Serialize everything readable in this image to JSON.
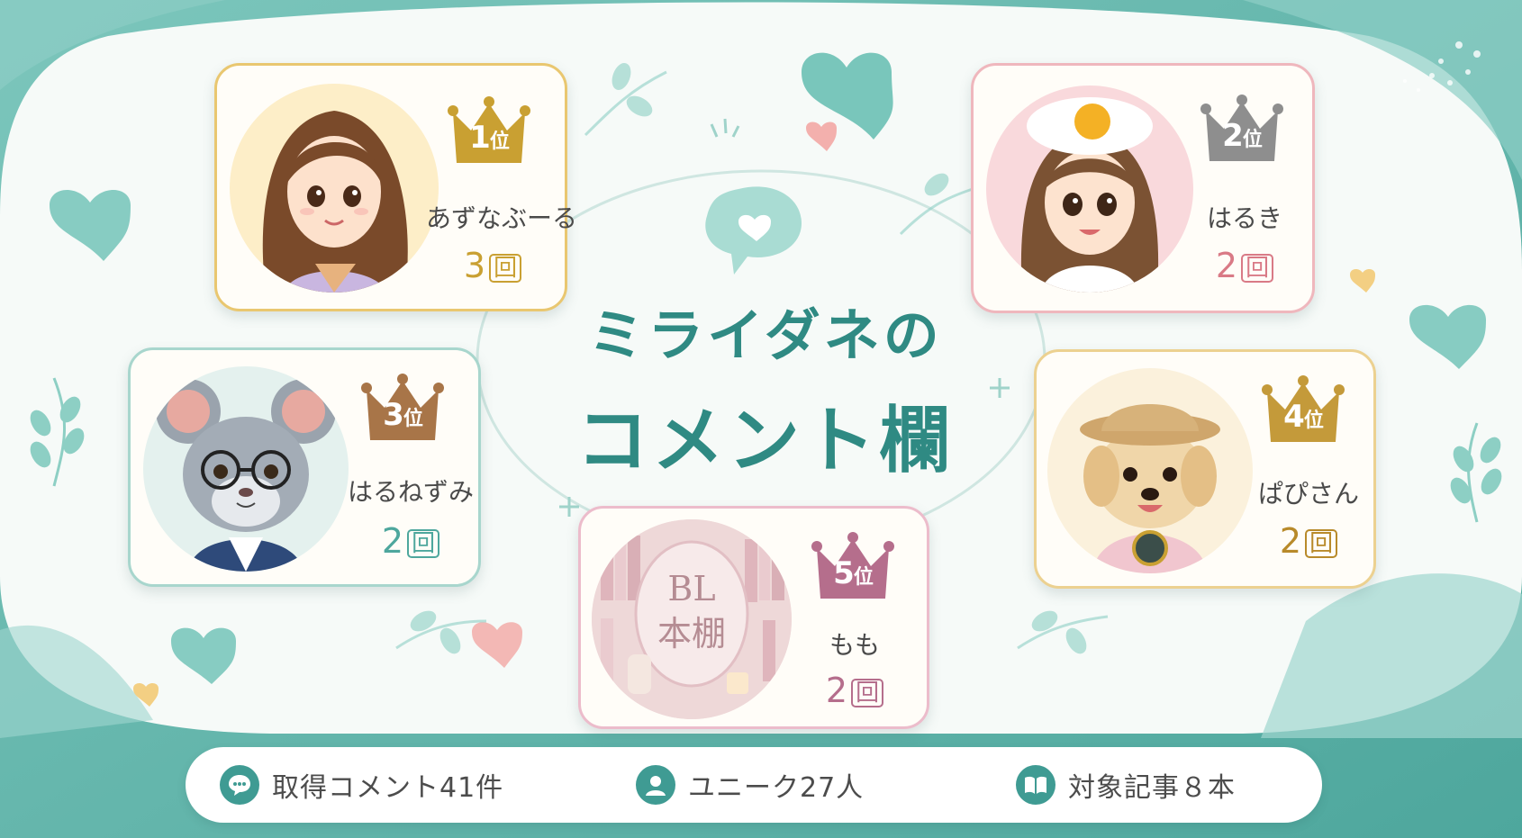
{
  "title": {
    "line1": "ミライダネの",
    "line2": "コメント欄"
  },
  "ranking": [
    {
      "rank_num": "1",
      "rank_suffix": "位",
      "name": "あずなぶーる",
      "count": "3",
      "unit": "回",
      "color": "#c9a032"
    },
    {
      "rank_num": "2",
      "rank_suffix": "位",
      "name": "はるき",
      "count": "2",
      "unit": "回",
      "color": "#8e8e8e"
    },
    {
      "rank_num": "3",
      "rank_suffix": "位",
      "name": "はるねずみ",
      "count": "2",
      "unit": "回",
      "color": "#a87548"
    },
    {
      "rank_num": "4",
      "rank_suffix": "位",
      "name": "ぱぴさん",
      "count": "2",
      "unit": "回",
      "color": "#c49a3a"
    },
    {
      "rank_num": "5",
      "rank_suffix": "位",
      "name": "もも",
      "count": "2",
      "unit": "回",
      "color": "#b56e8c"
    }
  ],
  "avatar5_text": {
    "line1": "BL",
    "line2": "本棚"
  },
  "stats": [
    {
      "label": "取得コメント41件",
      "icon": "comment-icon"
    },
    {
      "label": "ユニーク27人",
      "icon": "user-icon"
    },
    {
      "label": "対象記事８本",
      "icon": "book-icon"
    }
  ],
  "colors": {
    "teal": "#5fb5ab",
    "title": "#2f8a83",
    "gold": "#c9a032",
    "silver": "#8e8e8e",
    "bronze": "#a87548",
    "pink": "#b56e8c"
  }
}
